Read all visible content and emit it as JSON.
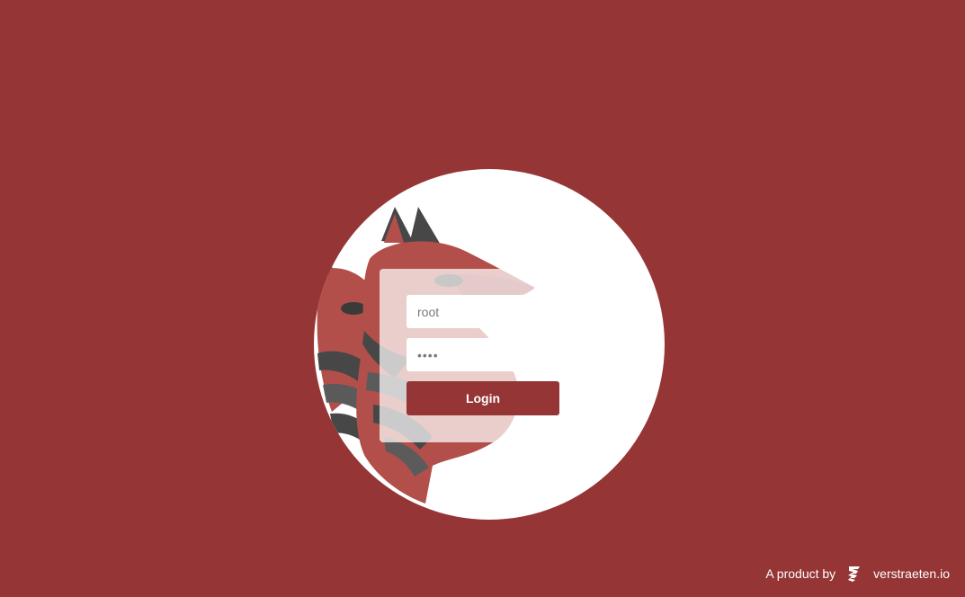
{
  "login": {
    "username_value": "root",
    "password_value": "root",
    "button_label": "Login"
  },
  "footer": {
    "prefix": "A product by",
    "brand": "verstraeten.io",
    "brand_icon": "verstraeten-logo-icon"
  },
  "colors": {
    "background": "#953535",
    "card": "#ffffff",
    "button": "#953535",
    "fox_red": "#b24f4a",
    "fox_dark": "#474747"
  }
}
